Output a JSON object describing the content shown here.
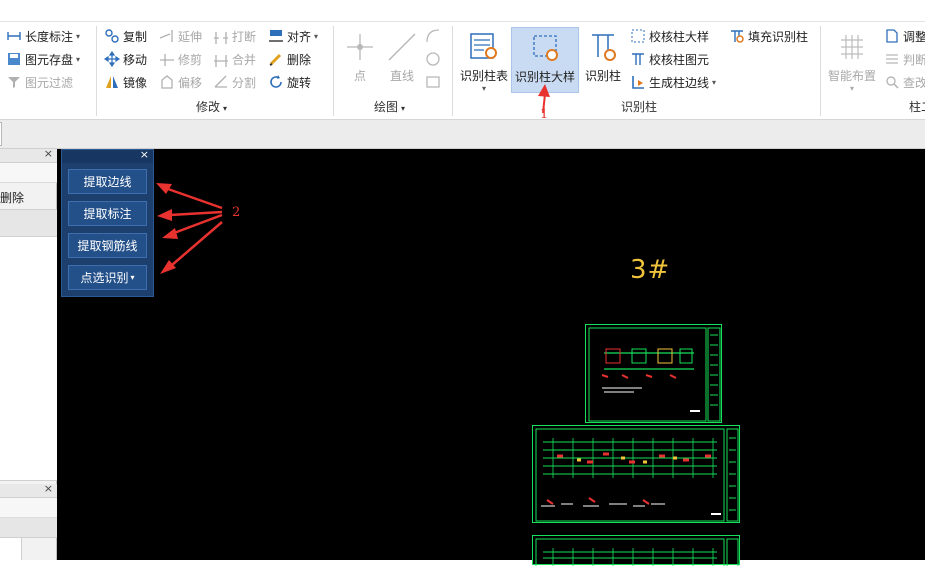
{
  "ribbon": {
    "group1": {
      "items": [
        {
          "label": "长度标注",
          "icon": "dimension-icon",
          "dropdown": true
        },
        {
          "label": "图元存盘",
          "icon": "save-element-icon",
          "dropdown": true
        },
        {
          "label": "图元过滤",
          "icon": "filter-icon",
          "disabled": true
        }
      ]
    },
    "modify": {
      "label": "修改",
      "col1": [
        {
          "label": "复制",
          "icon": "copy-icon"
        },
        {
          "label": "移动",
          "icon": "move-icon"
        },
        {
          "label": "镜像",
          "icon": "mirror-icon"
        }
      ],
      "col2": [
        {
          "label": "延伸",
          "icon": "extend-icon",
          "disabled": true
        },
        {
          "label": "修剪",
          "icon": "trim-icon",
          "disabled": true
        },
        {
          "label": "偏移",
          "icon": "offset-icon",
          "disabled": true
        }
      ],
      "col3": [
        {
          "label": "打断",
          "icon": "break-icon",
          "disabled": true
        },
        {
          "label": "合并",
          "icon": "merge-icon",
          "disabled": true
        },
        {
          "label": "分割",
          "icon": "split-icon",
          "disabled": true
        }
      ],
      "col4": [
        {
          "label": "对齐",
          "icon": "align-icon",
          "dropdown": true
        },
        {
          "label": "删除",
          "icon": "delete-icon"
        },
        {
          "label": "旋转",
          "icon": "rotate-icon"
        }
      ]
    },
    "draw": {
      "label": "绘图",
      "point_label": "点",
      "line_label": "直线"
    },
    "identify_column": {
      "label": "识别柱",
      "table_button": "识别柱表",
      "detail_button": "识别柱大样",
      "column_button": "识别柱",
      "check_detail": "校核柱大样",
      "check_element": "校核柱图元",
      "generate_edge": "生成柱边线",
      "fill_identify": "填充识别柱"
    },
    "smart_layout": {
      "label": "智能布置",
      "group_label": "柱二",
      "adjust": "调整",
      "judge": "判断",
      "modify": "查改"
    }
  },
  "left_panel": {
    "delete_label": "删除"
  },
  "float_panel": {
    "buttons": [
      "提取边线",
      "提取标注",
      "提取钢筋线",
      "点选识别"
    ]
  },
  "canvas": {
    "drawing_label": "3#"
  },
  "annotations": {
    "step1": "1",
    "step2": "2",
    "color": "#e8322f"
  },
  "colors": {
    "active_button": "#c9dbf2",
    "panel_bg": "#1d3f6e",
    "drawing_green": "#17e05a"
  }
}
